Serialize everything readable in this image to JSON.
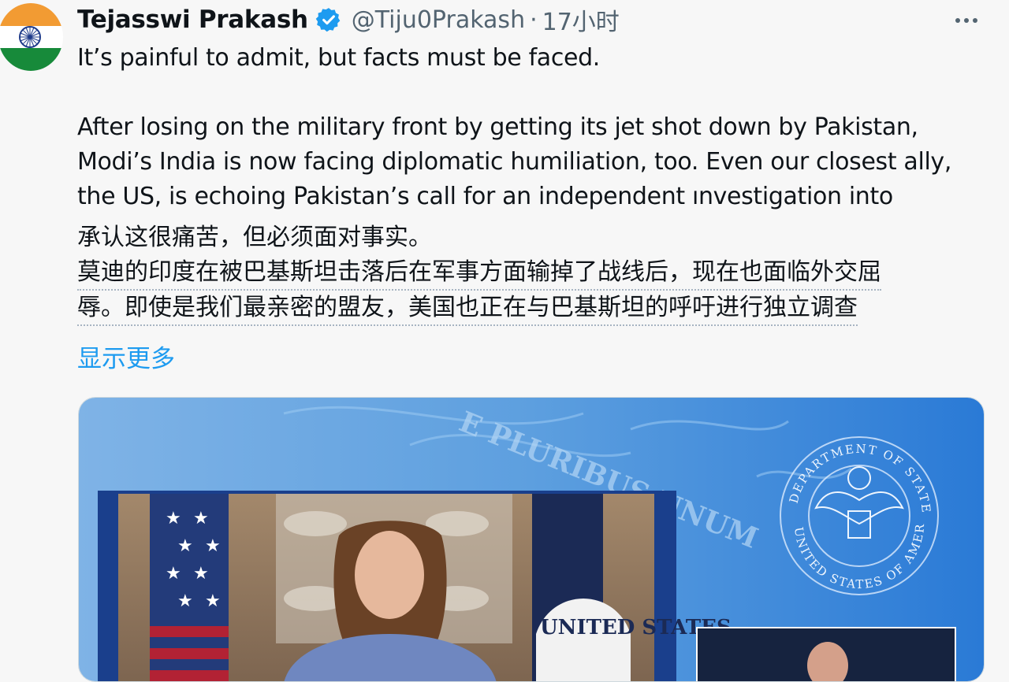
{
  "author": {
    "name": "Tejasswi Prakash",
    "handle": "@Tiju0Prakash",
    "separator": "·",
    "time": "17小时"
  },
  "tweet": {
    "lines": [
      "It’s painful to admit, but facts must be faced.",
      "After losing on the military front by getting its jet shot down by Pakistan,",
      "Modi’s India is now facing diplomatic humiliation, too. Even our closest ally,",
      "the US, is echoing Pakistan’s call for an independent ınvestigation into"
    ]
  },
  "translation": {
    "lines": [
      "承认这很痛苦，但必须面对事实。",
      "莫迪的印度在被巴基斯坦击落后在军事方面输掉了战线后，现在也面临外交屈",
      "辱。即使是我们最亲密的盟友，美国也正在与巴基斯坦的呼吁进行独立调查"
    ]
  },
  "show_more_label": "显示更多",
  "media": {
    "motto_text": "E PLURIBUS UNUM",
    "seal_top_text": "DEPARTMENT OF STATE",
    "seal_bottom_text": "UNITED STATES OF AMERICA",
    "banner_text": "UNITED STATES"
  },
  "icons": {
    "verified": "verified-badge-icon",
    "more": "more-horizontal-icon"
  },
  "colors": {
    "accent": "#1d9bf0",
    "secondary_text": "#536471"
  }
}
